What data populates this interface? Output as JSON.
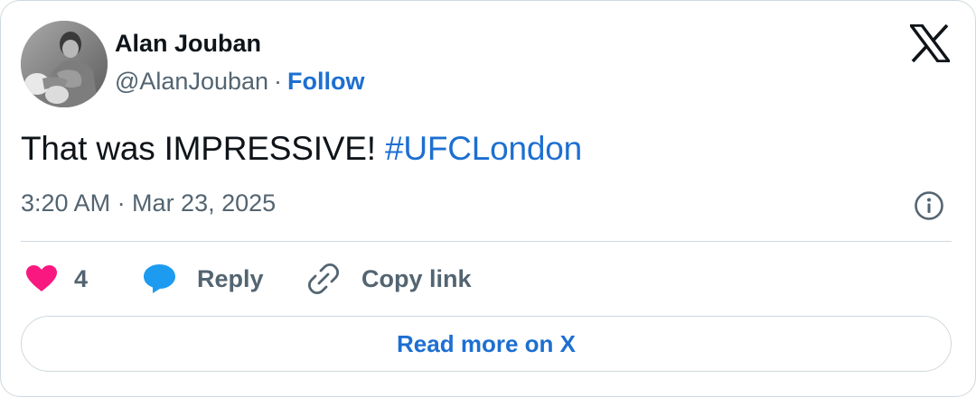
{
  "author": {
    "name": "Alan Jouban",
    "handle": "@AlanJouban",
    "separator": "·",
    "follow_label": "Follow"
  },
  "tweet": {
    "text": "That was IMPRESSIVE! ",
    "hashtag": "#UFCLondon",
    "timestamp": "3:20 AM · Mar 23, 2025"
  },
  "actions": {
    "like_count": "4",
    "reply_label": "Reply",
    "copy_label": "Copy link"
  },
  "read_more_label": "Read more on X",
  "colors": {
    "link": "#1d6fd1",
    "like": "#f91880",
    "reply": "#1d9bf0",
    "muted": "#536471",
    "border": "#cfd9de"
  },
  "icons": {
    "brand": "x-logo-icon",
    "info": "info-icon",
    "like": "heart-icon",
    "reply": "speech-bubble-icon",
    "copy": "link-icon"
  }
}
